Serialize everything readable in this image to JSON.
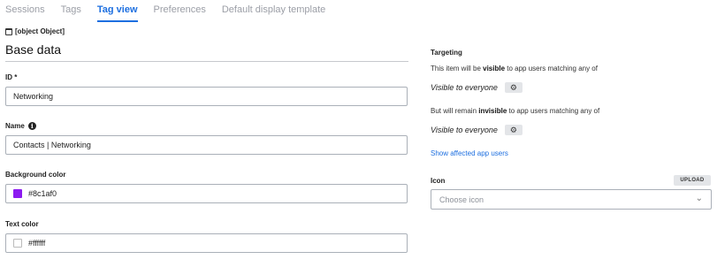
{
  "tabs": [
    {
      "label": "Sessions"
    },
    {
      "label": "Tags"
    },
    {
      "label": "Tag view"
    },
    {
      "label": "Preferences"
    },
    {
      "label": "Default display template"
    }
  ],
  "active_tab": "Tag view",
  "object_line": "[object Object]",
  "section_title": "Base data",
  "fields": {
    "id": {
      "label": "ID *",
      "value": "Networking"
    },
    "name": {
      "label": "Name",
      "value": "Contacts | Networking"
    },
    "background_color": {
      "label": "Background color",
      "value": "#8c1af0",
      "swatch": "#8c1af0"
    },
    "text_color": {
      "label": "Text color",
      "value": "#ffffff",
      "swatch": "#ffffff"
    }
  },
  "targeting": {
    "heading": "Targeting",
    "visible_prefix": "This item will be ",
    "visible_word": "visible",
    "visible_suffix": " to app users matching any of",
    "visible_value": "Visible to everyone",
    "invisible_prefix": "But will remain ",
    "invisible_word": "invisible",
    "invisible_suffix": " to app users matching any of",
    "invisible_value": "Visible to everyone",
    "link": "Show affected app users"
  },
  "icon_field": {
    "label": "Icon",
    "upload_label": "UPLOAD",
    "placeholder": "Choose icon"
  },
  "colors": {
    "accent": "#1d6fe0",
    "purple_swatch": "#8c1af0"
  }
}
